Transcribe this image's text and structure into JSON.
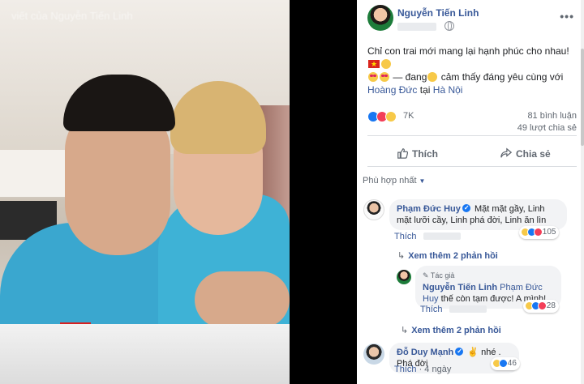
{
  "viewer": {
    "caption_blurred": "viết của Nguyễn Tiến Linh"
  },
  "post": {
    "author": "Nguyễn Tiến Linh",
    "text_line1": "Chỉ con trai mới mang lại hạnh phúc cho nhau!",
    "text_feeling": "— đang",
    "text_feeling_rest": "cảm thấy đáng yêu cùng với",
    "tag_person": "Hoàng Đức",
    "text_at": "tại",
    "tag_place": "Hà Nội",
    "icons": [
      "globe-icon",
      "more-icon"
    ]
  },
  "stats": {
    "reactions_count": "7K",
    "comments": "81 bình luận",
    "shares": "49 lượt chia sẻ"
  },
  "actions": {
    "like_label": "Thích",
    "share_label": "Chia sẻ"
  },
  "sort": {
    "label": "Phù hợp nhất"
  },
  "comments": [
    {
      "name": "Phạm Đức Huy",
      "text": "Mặt mặt gầy, Linh mặt lưỡi cầy, Linh phá đời, Linh ăn lìn",
      "like_label": "Thích",
      "reactions": "105",
      "more_replies": "Xem thêm 2 phản hồi"
    },
    {
      "author_tag": "Tác giả",
      "name": "Nguyễn Tiến Linh",
      "mention": "Phạm Đức Huy",
      "text": "thế còn tạm được! A mình!",
      "like_label": "Thích",
      "reactions": "28",
      "more_replies": "Xem thêm 2 phản hồi"
    },
    {
      "name": "Đỗ Duy Mạnh",
      "text": "nhé . Phá đời",
      "like_label": "Thích",
      "time": "4 ngày",
      "reactions": "46"
    }
  ],
  "colors": {
    "link": "#385898",
    "like_blue": "#1877f2",
    "love_red": "#f33e58",
    "haha_yellow": "#f7c948",
    "bubble_bg": "#f2f3f5"
  }
}
